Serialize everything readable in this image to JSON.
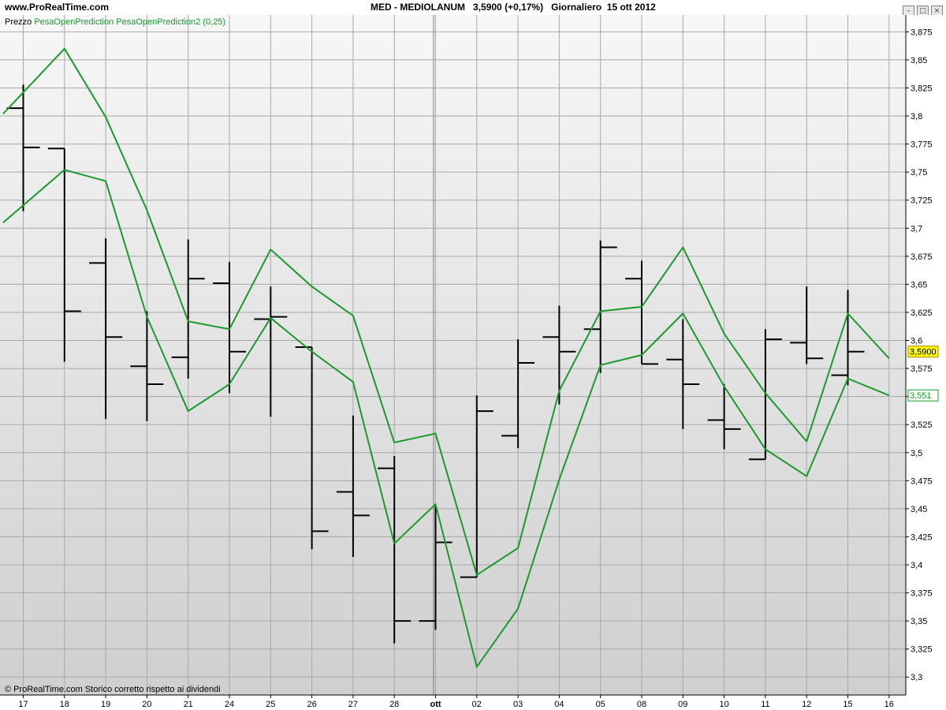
{
  "header": {
    "site": "www.ProRealTime.com",
    "instrument": "MED - MEDIOLANUM",
    "price": "3,5900",
    "change": "(+0,17%)",
    "period": "Giornaliero",
    "date": "15 ott 2012"
  },
  "legend": {
    "price_label": "Prezzo",
    "indicator1": "PesaOpenPrediction",
    "indicator2": "PesaOpenPrediction2 (0,25)"
  },
  "footer": {
    "copyright": "© ProRealTime.com  Storico corretto rispetto ai dividendi"
  },
  "colors": {
    "background_top": "#f7f7f7",
    "background_bottom": "#cfcfcf",
    "grid": "#a8a8a8",
    "bars": "#000000",
    "indicator": "#1a9a2a",
    "price_tag": "#ffff00"
  },
  "chart_data": {
    "type": "ohlc",
    "x": [
      "17",
      "18",
      "19",
      "20",
      "21",
      "24",
      "25",
      "26",
      "27",
      "28",
      "ott",
      "02",
      "03",
      "04",
      "05",
      "08",
      "09",
      "10",
      "11",
      "12",
      "15",
      "16"
    ],
    "ylim": [
      3.284,
      3.89
    ],
    "yticks": [
      3.3,
      3.325,
      3.35,
      3.375,
      3.4,
      3.425,
      3.45,
      3.475,
      3.5,
      3.525,
      3.55,
      3.575,
      3.6,
      3.625,
      3.65,
      3.675,
      3.7,
      3.725,
      3.75,
      3.775,
      3.8,
      3.825,
      3.85,
      3.875
    ],
    "ohlc": [
      {
        "o": 3.807,
        "h": 3.828,
        "l": 3.715,
        "c": 3.772
      },
      {
        "o": 3.771,
        "h": 3.771,
        "l": 3.581,
        "c": 3.626
      },
      {
        "o": 3.669,
        "h": 3.691,
        "l": 3.53,
        "c": 3.603
      },
      {
        "o": 3.577,
        "h": 3.626,
        "l": 3.528,
        "c": 3.561
      },
      {
        "o": 3.585,
        "h": 3.69,
        "l": 3.566,
        "c": 3.655
      },
      {
        "o": 3.651,
        "h": 3.67,
        "l": 3.553,
        "c": 3.59
      },
      {
        "o": 3.619,
        "h": 3.648,
        "l": 3.532,
        "c": 3.621
      },
      {
        "o": 3.594,
        "h": 3.594,
        "l": 3.414,
        "c": 3.43
      },
      {
        "o": 3.465,
        "h": 3.533,
        "l": 3.407,
        "c": 3.444
      },
      {
        "o": 3.486,
        "h": 3.497,
        "l": 3.33,
        "c": 3.35
      },
      {
        "o": 3.35,
        "h": 3.453,
        "l": 3.342,
        "c": 3.42
      },
      {
        "o": 3.389,
        "h": 3.551,
        "l": 3.389,
        "c": 3.537
      },
      {
        "o": 3.515,
        "h": 3.601,
        "l": 3.504,
        "c": 3.58
      },
      {
        "o": 3.603,
        "h": 3.631,
        "l": 3.543,
        "c": 3.59
      },
      {
        "o": 3.61,
        "h": 3.689,
        "l": 3.571,
        "c": 3.683
      },
      {
        "o": 3.655,
        "h": 3.671,
        "l": 3.579,
        "c": 3.579
      },
      {
        "o": 3.583,
        "h": 3.619,
        "l": 3.521,
        "c": 3.561
      },
      {
        "o": 3.529,
        "h": 3.561,
        "l": 3.503,
        "c": 3.521
      },
      {
        "o": 3.494,
        "h": 3.61,
        "l": 3.494,
        "c": 3.601
      },
      {
        "o": 3.598,
        "h": 3.648,
        "l": 3.579,
        "c": 3.584
      },
      {
        "o": 3.569,
        "h": 3.645,
        "l": 3.56,
        "c": 3.59
      }
    ],
    "series": [
      {
        "name": "PesaOpenPrediction",
        "values": [
          3.802,
          3.86,
          3.799,
          3.716,
          3.617,
          3.61,
          3.681,
          3.648,
          3.622,
          3.509,
          3.517,
          3.391,
          3.415,
          3.555,
          3.626,
          3.63,
          3.683,
          3.606,
          3.553,
          3.51,
          3.624,
          3.584
        ]
      },
      {
        "name": "PesaOpenPrediction2 (0,25)",
        "values": [
          3.705,
          3.752,
          3.742,
          3.621,
          3.537,
          3.561,
          3.62,
          3.59,
          3.563,
          3.419,
          3.454,
          3.309,
          3.361,
          3.476,
          3.578,
          3.587,
          3.624,
          3.559,
          3.503,
          3.479,
          3.566,
          3.551
        ]
      }
    ],
    "price_tags": [
      "3,5900",
      "3,551"
    ]
  }
}
